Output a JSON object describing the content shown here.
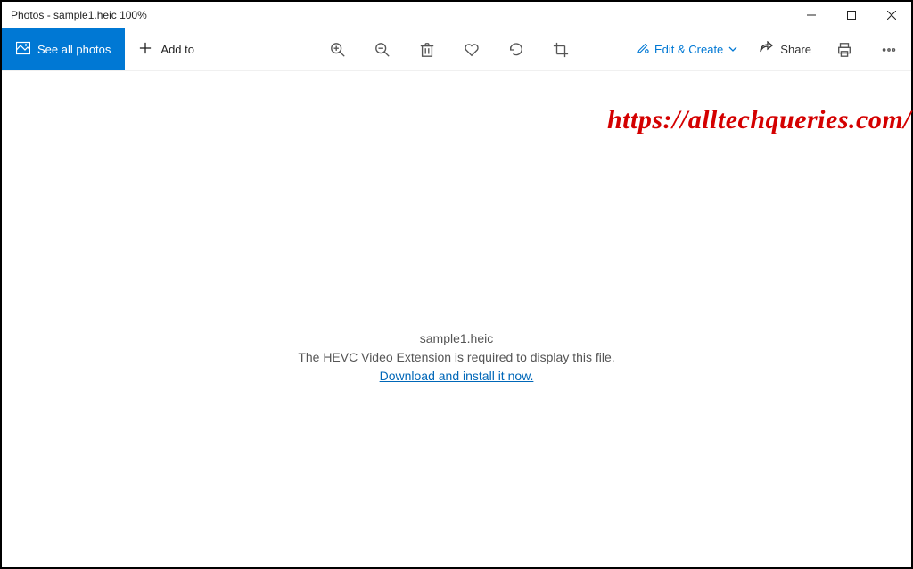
{
  "titlebar": {
    "title": "Photos - sample1.heic   100%"
  },
  "toolbar": {
    "see_all_label": "See all photos",
    "add_to_label": "Add to",
    "edit_create_label": "Edit & Create",
    "share_label": "Share"
  },
  "content": {
    "filename": "sample1.heic",
    "message": "The HEVC Video Extension is required to display this file.",
    "download_link": "Download and install it now."
  },
  "watermark": "https://alltechqueries.com/"
}
